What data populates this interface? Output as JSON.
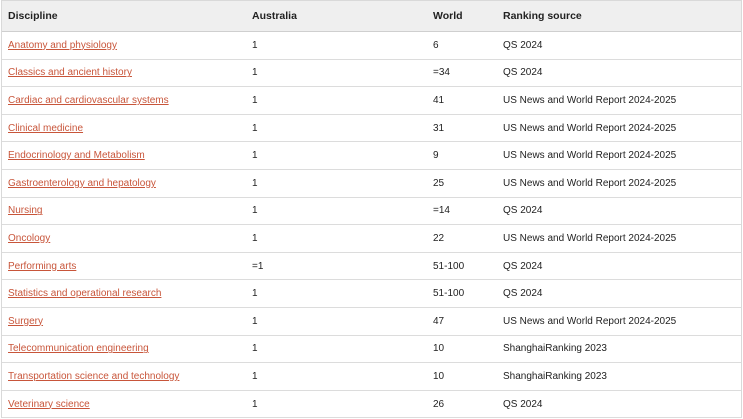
{
  "table": {
    "headers": [
      "Discipline",
      "Australia",
      "World",
      "Ranking source"
    ],
    "rows": [
      {
        "discipline": "Anatomy and physiology",
        "australia": "1",
        "world": "6",
        "source": "QS 2024"
      },
      {
        "discipline": "Classics and ancient history",
        "australia": "1",
        "world": "=34",
        "source": "QS 2024"
      },
      {
        "discipline": "Cardiac and cardiovascular systems",
        "australia": "1",
        "world": "41",
        "source": "US News and World Report 2024-2025"
      },
      {
        "discipline": "Clinical medicine",
        "australia": "1",
        "world": "31",
        "source": "US News and World Report 2024-2025"
      },
      {
        "discipline": "Endocrinology and Metabolism",
        "australia": "1",
        "world": "9",
        "source": "US News and World Report 2024-2025"
      },
      {
        "discipline": "Gastroenterology and hepatology",
        "australia": "1",
        "world": "25",
        "source": "US News and World Report 2024-2025"
      },
      {
        "discipline": "Nursing",
        "australia": "1",
        "world": "=14",
        "source": "QS 2024"
      },
      {
        "discipline": "Oncology",
        "australia": "1",
        "world": "22",
        "source": "US News and World Report 2024-2025"
      },
      {
        "discipline": "Performing arts",
        "australia": "=1",
        "world": "51-100",
        "source": "QS 2024"
      },
      {
        "discipline": "Statistics and operational research",
        "australia": "1",
        "world": "51-100",
        "source": "QS 2024"
      },
      {
        "discipline": "Surgery",
        "australia": "1",
        "world": "47",
        "source": "US News and World Report 2024-2025"
      },
      {
        "discipline": "Telecommunication engineering",
        "australia": "1",
        "world": "10",
        "source": "ShanghaiRanking 2023"
      },
      {
        "discipline": "Transportation science and technology",
        "australia": "1",
        "world": "10",
        "source": "ShanghaiRanking 2023"
      },
      {
        "discipline": "Veterinary science",
        "australia": "1",
        "world": "26",
        "source": "QS 2024"
      }
    ]
  },
  "colors": {
    "link": "#c8553a",
    "header_bg": "#efefef",
    "row_border": "#dcdcdc"
  }
}
